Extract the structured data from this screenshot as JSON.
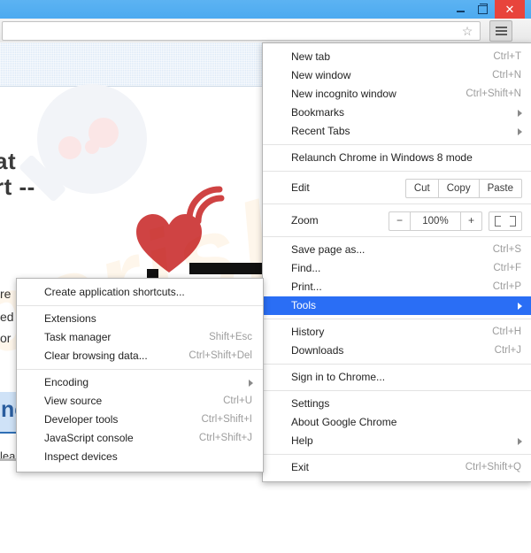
{
  "window": {
    "minimize_label": "Minimize",
    "maximize_label": "Restore",
    "close_label": "Close",
    "titlebar_color": "#4daaf0",
    "close_color": "#e8443c"
  },
  "toolbar": {
    "omnibox_value": "",
    "omnibox_placeholder": "",
    "star_icon": "star-icon",
    "menu_icon": "hamburger-menu-icon"
  },
  "page": {
    "hero_line_1": "at",
    "hero_line_2": "rt --",
    "fragment_left_1": "re",
    "fragment_left_2": "ed",
    "fragment_left_3": "or",
    "blue_chip_text": "nc",
    "fragment_below": "leal",
    "watermark_text": "pcrisk.com"
  },
  "main_menu": {
    "items": [
      {
        "label": "New tab",
        "shortcut": "Ctrl+T",
        "arrow": false,
        "selected": false
      },
      {
        "label": "New window",
        "shortcut": "Ctrl+N",
        "arrow": false,
        "selected": false
      },
      {
        "label": "New incognito window",
        "shortcut": "Ctrl+Shift+N",
        "arrow": false,
        "selected": false
      },
      {
        "label": "Bookmarks",
        "shortcut": "",
        "arrow": true,
        "selected": false
      },
      {
        "label": "Recent Tabs",
        "shortcut": "",
        "arrow": true,
        "selected": false
      }
    ],
    "relaunch": {
      "label": "Relaunch Chrome in Windows 8 mode",
      "shortcut": "",
      "arrow": false
    },
    "edit_row": {
      "label": "Edit",
      "cut_label": "Cut",
      "copy_label": "Copy",
      "paste_label": "Paste"
    },
    "zoom_row": {
      "label": "Zoom",
      "minus_label": "−",
      "value": "100%",
      "plus_label": "+",
      "fullscreen_label": "Full screen"
    },
    "items_2": [
      {
        "label": "Save page as...",
        "shortcut": "Ctrl+S",
        "arrow": false,
        "selected": false
      },
      {
        "label": "Find...",
        "shortcut": "Ctrl+F",
        "arrow": false,
        "selected": false
      },
      {
        "label": "Print...",
        "shortcut": "Ctrl+P",
        "arrow": false,
        "selected": false
      },
      {
        "label": "Tools",
        "shortcut": "",
        "arrow": true,
        "selected": true
      }
    ],
    "items_3": [
      {
        "label": "History",
        "shortcut": "Ctrl+H",
        "arrow": false,
        "selected": false
      },
      {
        "label": "Downloads",
        "shortcut": "Ctrl+J",
        "arrow": false,
        "selected": false
      }
    ],
    "items_4": [
      {
        "label": "Sign in to Chrome...",
        "shortcut": "",
        "arrow": false,
        "selected": false
      }
    ],
    "items_5": [
      {
        "label": "Settings",
        "shortcut": "",
        "arrow": false,
        "selected": false
      },
      {
        "label": "About Google Chrome",
        "shortcut": "",
        "arrow": false,
        "selected": false
      },
      {
        "label": "Help",
        "shortcut": "",
        "arrow": true,
        "selected": false
      }
    ],
    "items_6": [
      {
        "label": "Exit",
        "shortcut": "Ctrl+Shift+Q",
        "arrow": false,
        "selected": false
      }
    ],
    "highlight_color": "#2a6ef5"
  },
  "tools_submenu": {
    "group_1": [
      {
        "label": "Create application shortcuts...",
        "shortcut": "",
        "arrow": false
      }
    ],
    "group_2": [
      {
        "label": "Extensions",
        "shortcut": "",
        "arrow": false
      },
      {
        "label": "Task manager",
        "shortcut": "Shift+Esc",
        "arrow": false
      },
      {
        "label": "Clear browsing data...",
        "shortcut": "Ctrl+Shift+Del",
        "arrow": false
      }
    ],
    "group_3": [
      {
        "label": "Encoding",
        "shortcut": "",
        "arrow": true
      },
      {
        "label": "View source",
        "shortcut": "Ctrl+U",
        "arrow": false
      },
      {
        "label": "Developer tools",
        "shortcut": "Ctrl+Shift+I",
        "arrow": false
      },
      {
        "label": "JavaScript console",
        "shortcut": "Ctrl+Shift+J",
        "arrow": false
      },
      {
        "label": "Inspect devices",
        "shortcut": "",
        "arrow": false
      }
    ]
  }
}
